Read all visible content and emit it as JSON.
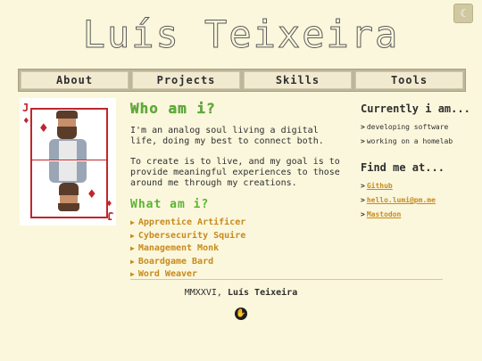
{
  "header": {
    "title": "Luís Teixeira",
    "theme_toggle_icon": "moon-icon"
  },
  "nav": {
    "items": [
      "About",
      "Projects",
      "Skills",
      "Tools"
    ]
  },
  "card": {
    "rank": "J",
    "suit_icon": "diamond-icon"
  },
  "main": {
    "heading": "Who am i?",
    "paragraph1": "I'm an analog soul living a digital life, doing my best to connect both.",
    "paragraph2": "To create is to live, and my goal is to provide meaningful experiences to those around me through my creations.",
    "subheading": "What am i?",
    "roles": [
      "Apprentice Artificer",
      "Cybersecurity Squire",
      "Management Monk",
      "Boardgame Bard",
      "Word Weaver"
    ]
  },
  "sidebar": {
    "currently_heading": "Currently i am...",
    "currently_items": [
      "developing software",
      "working on a homelab"
    ],
    "find_heading": "Find me at...",
    "links": [
      "Github",
      "hello.lumi@pm.me",
      "Mastodon"
    ]
  },
  "footer": {
    "year": "MMXXVI,",
    "name": "Luís Teixeira",
    "hand_icon": "hand-icon"
  },
  "colors": {
    "background": "#fbf7dc",
    "accent_green": "#5cb335",
    "accent_orange": "#c88a1e",
    "card_red": "#c0262c"
  }
}
